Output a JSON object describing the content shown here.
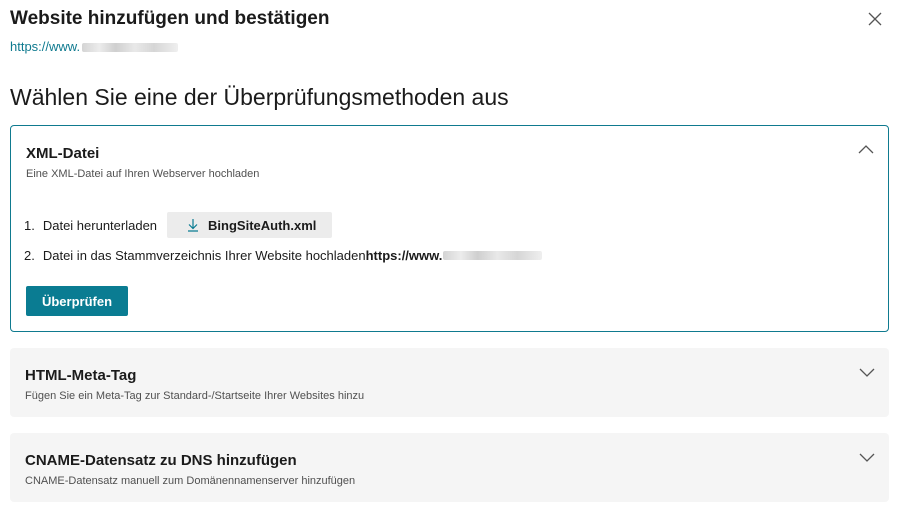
{
  "dialog": {
    "title": "Website hinzufügen und bestätigen",
    "site_url_prefix": "https://www."
  },
  "heading": "Wählen Sie eine der Überprüfungsmethoden aus",
  "methods": [
    {
      "title": "XML-Datei",
      "subtitle": "Eine XML-Datei auf Ihren Webserver hochladen",
      "expanded": true,
      "steps": [
        {
          "num": "1.",
          "text": "Datei herunterladen",
          "button_label": "BingSiteAuth.xml"
        },
        {
          "num": "2.",
          "text": "Datei in das Stammverzeichnis Ihrer Website hochladen",
          "url_prefix": "https://www."
        }
      ],
      "verify_label": "Überprüfen"
    },
    {
      "title": "HTML-Meta-Tag",
      "subtitle": "Fügen Sie ein Meta-Tag zur Standard-/Startseite Ihrer Websites hinzu",
      "expanded": false
    },
    {
      "title": "CNAME-Datensatz zu DNS hinzufügen",
      "subtitle": "CNAME-Datensatz manuell zum Domänennamenserver hinzufügen",
      "expanded": false
    }
  ],
  "icons": {
    "close": "close-icon",
    "collapse": "chevron-up-icon",
    "expand": "chevron-down-icon",
    "download": "download-icon"
  },
  "colors": {
    "accent": "#0a7c92",
    "link": "#0f7a8f",
    "card_bg": "#f5f5f5"
  }
}
